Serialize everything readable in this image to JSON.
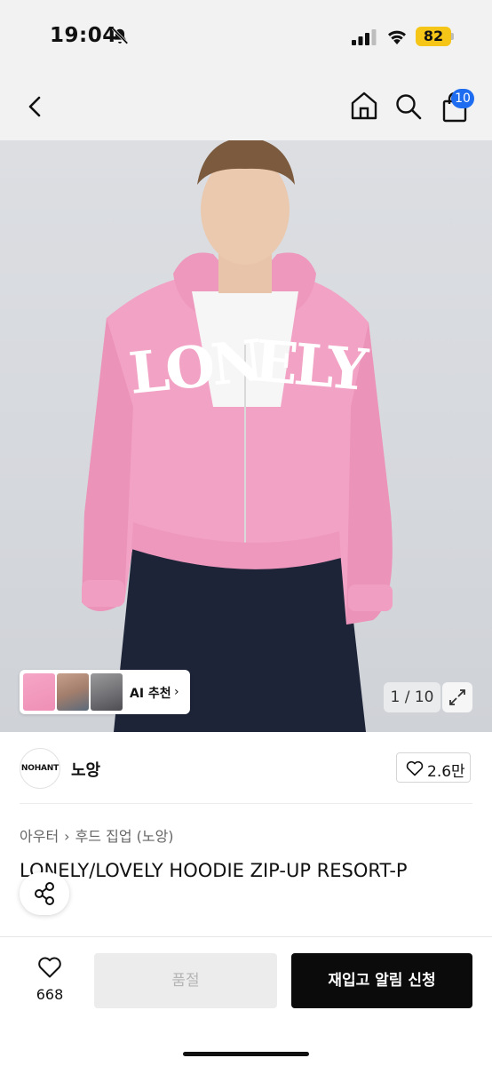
{
  "status_bar": {
    "time": "19:04",
    "battery": "82",
    "icons": [
      "bell-off-icon",
      "signal-icon",
      "wifi-icon",
      "battery-icon"
    ]
  },
  "nav": {
    "icons": [
      "back-icon",
      "home-icon",
      "search-icon",
      "shopping-bag-icon"
    ],
    "cart_badge": "10"
  },
  "product_image": {
    "printed_text": "LONELY",
    "thumbnails": [
      "thumb-pink-hoodie",
      "thumb-model-2",
      "thumb-model-3"
    ],
    "ai_label": "AI 추천",
    "counter": "1 / 10",
    "colors": {
      "hoodie": "#f2a3c5",
      "background": "#d8dade"
    }
  },
  "brand": {
    "logo_text": "NOHANT",
    "name": "노앙",
    "likes": "2.6만"
  },
  "breadcrumb": [
    "아우터",
    "후드 집업 (노앙)"
  ],
  "product": {
    "title": "LONELY/LOVELY HOODIE ZIP-UP RESORT-P"
  },
  "bottom_bar": {
    "wish_count": "668",
    "soldout_label": "품절",
    "notify_label": "재입고 알림 신청",
    "colors": {
      "primary": "#0b0b0b",
      "disabled": "#ececec",
      "accent": "#1e6cf0"
    }
  }
}
